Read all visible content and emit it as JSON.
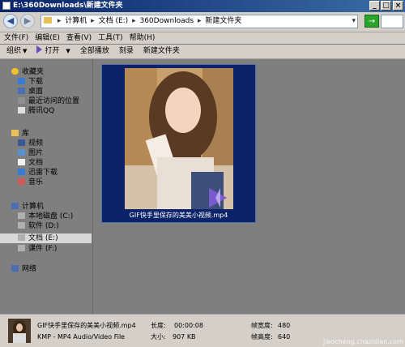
{
  "window": {
    "title": "E:\\360Downloads\\新建文件夹",
    "minimize_glyph": "_",
    "maximize_glyph": "□",
    "close_glyph": "×"
  },
  "address": {
    "back_glyph": "◀",
    "forward_glyph": "▶",
    "crumbs": [
      "计算机",
      "文档 (E:)",
      "360Downloads",
      "新建文件夹"
    ],
    "crumb_separator": "▸",
    "dropdown_glyph": "▾",
    "go_glyph": "→"
  },
  "menu": {
    "items": [
      "文件(F)",
      "编辑(E)",
      "查看(V)",
      "工具(T)",
      "帮助(H)"
    ]
  },
  "toolbar": {
    "organize": "组织",
    "play": "打开",
    "play_all": "全部播放",
    "burn": "刻录",
    "new_folder": "新建文件夹",
    "caret": "▼"
  },
  "nav": {
    "favorites_header": "收藏夹",
    "favorites": [
      "下载",
      "桌面",
      "最近访问的位置",
      "腾讯QQ"
    ],
    "libraries_header": "库",
    "libraries": [
      "视频",
      "图片",
      "文档",
      "迅雷下载",
      "音乐"
    ],
    "computer_header": "计算机",
    "drives": [
      "本地磁盘 (C:)",
      "软件 (D:)",
      "文档 (E:)",
      "课件 (F:)"
    ],
    "selected_drive": "文档 (E:)",
    "network_header": "网络"
  },
  "file": {
    "name": "GIF快手里保存的美美小视频.mp4",
    "caption": "GIF快手里保存的美美小视频.mp4"
  },
  "status": {
    "filename": "GIF快手里保存的美美小视频.mp4",
    "length_label": "长度:",
    "length_value": "00:00:08",
    "type": "KMP - MP4 Audio/Video File",
    "size_label": "大小:",
    "size_value": "907 KB",
    "frame_width_label": "帧宽度:",
    "frame_width_value": "480",
    "frame_height_label": "帧高度:",
    "frame_height_value": "640"
  },
  "watermark": "jiaocheng.chazidian.com",
  "colors": {
    "tile_background": "#0c2369",
    "title_bar": "#0a246a",
    "content_background": "#7f7f7f"
  }
}
